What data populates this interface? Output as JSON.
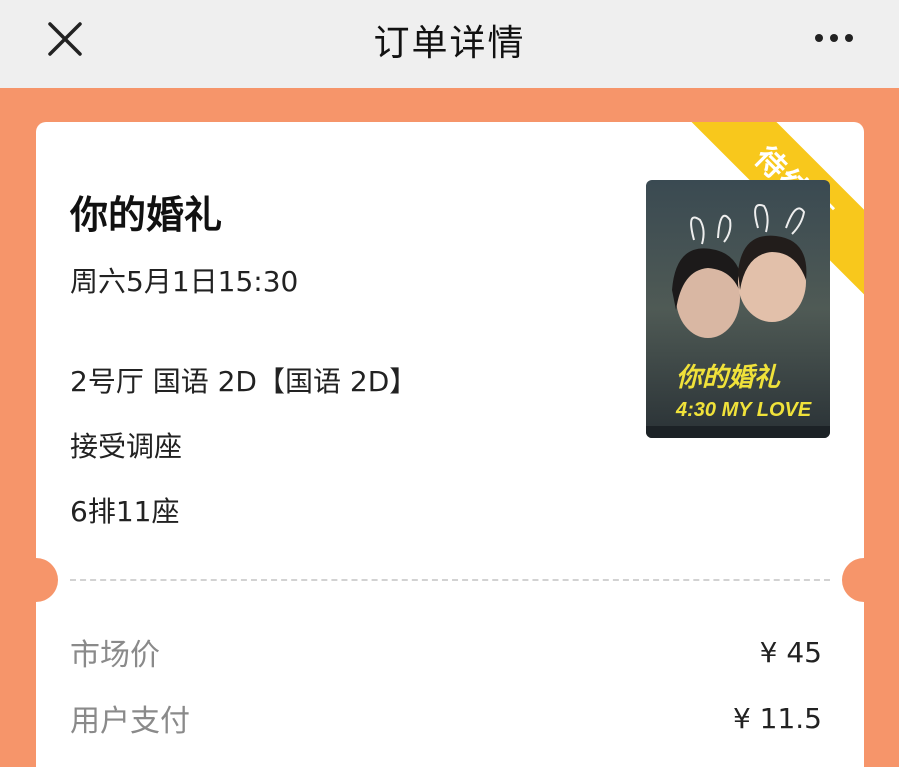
{
  "header": {
    "title": "订单详情",
    "close_icon": "close-icon",
    "more_icon": "more-horizontal-icon"
  },
  "status_badge": "待结算",
  "movie": {
    "name": "你的婚礼",
    "showtime": "周六5月1日15:30",
    "hall": "2号厅 国语 2D【国语 2D】",
    "adjust": "接受调座",
    "seat": "6排11座",
    "poster_title": "你的婚礼",
    "poster_subtitle": "4:30 MY LOVE"
  },
  "prices": [
    {
      "label": "市场价",
      "value": "¥ 45"
    },
    {
      "label": "用户支付",
      "value": "¥ 11.5"
    }
  ],
  "colors": {
    "background": "#f6956a",
    "header_bg": "#efefef",
    "badge": "#f8c81c"
  }
}
